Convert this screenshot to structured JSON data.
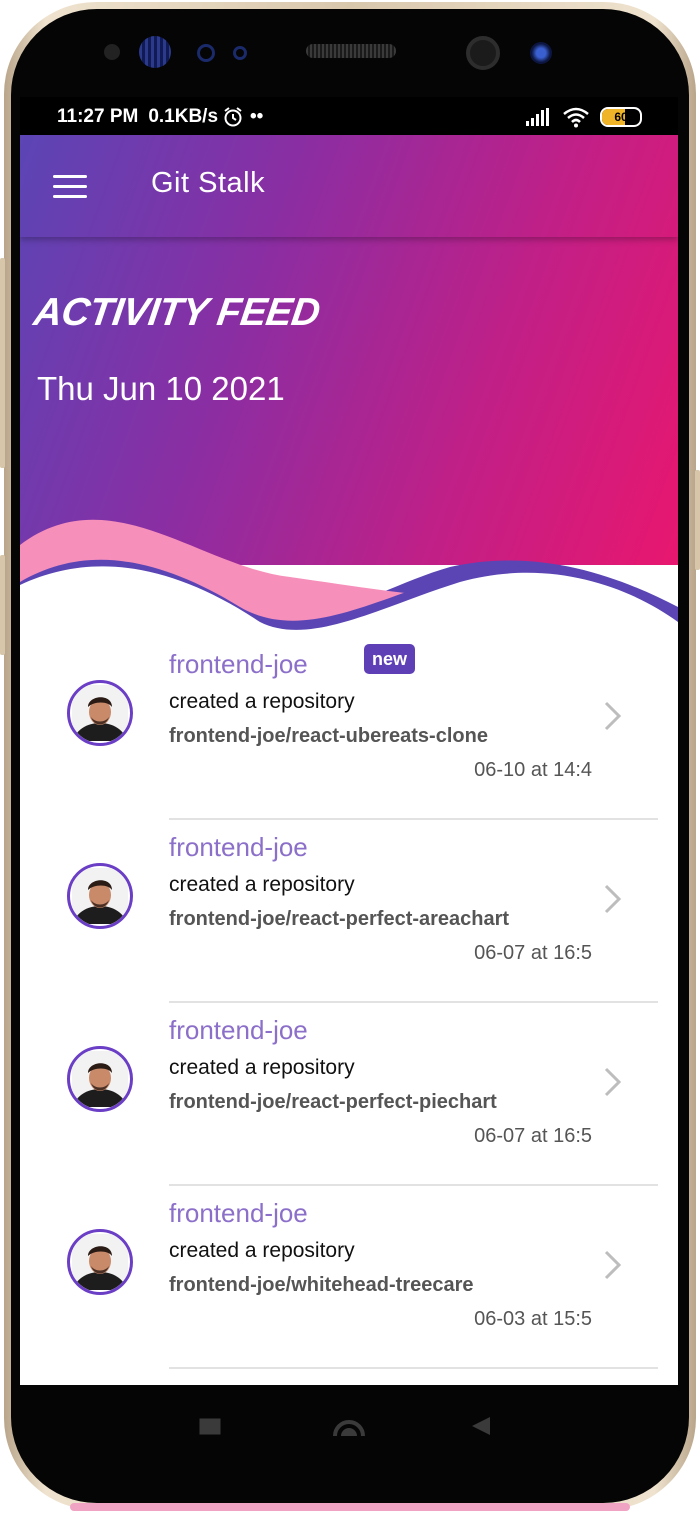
{
  "status_bar": {
    "time": "11:27 PM",
    "net_speed": "0.1KB/s",
    "dots": "••",
    "battery_level": "60",
    "battery_percent": 60
  },
  "app": {
    "title": "Git Stalk"
  },
  "header": {
    "heading": "ACTIVITY FEED",
    "date": "Thu Jun 10 2021"
  },
  "feed": [
    {
      "user": "frontend-joe",
      "badge": "new",
      "action": "created a repository",
      "repo": "frontend-joe/react-ubereats-clone",
      "time": "06-10 at 14:4"
    },
    {
      "user": "frontend-joe",
      "badge": "",
      "action": "created a repository",
      "repo": "frontend-joe/react-perfect-areachart",
      "time": "06-07 at 16:5"
    },
    {
      "user": "frontend-joe",
      "badge": "",
      "action": "created a repository",
      "repo": "frontend-joe/react-perfect-piechart",
      "time": "06-07 at 16:5"
    },
    {
      "user": "frontend-joe",
      "badge": "",
      "action": "created a repository",
      "repo": "frontend-joe/whitehead-treecare",
      "time": "06-03 at 15:5"
    }
  ],
  "colors": {
    "gradient_start": "#5b45b5",
    "gradient_end": "#e8176f",
    "username": "#8b6fc9",
    "badge": "#5e3fb5",
    "wave_pink": "#f78fbb",
    "wave_purple": "#5b45b5"
  },
  "icons": {
    "menu": "hamburger-menu-icon",
    "alarm": "alarm-clock-icon",
    "signal": "signal-bars-icon",
    "wifi": "wifi-icon",
    "battery": "battery-icon",
    "chevron": "chevron-right-icon",
    "nav_recent": "square-recents-icon",
    "nav_home": "circle-home-icon",
    "nav_back": "triangle-back-icon"
  }
}
